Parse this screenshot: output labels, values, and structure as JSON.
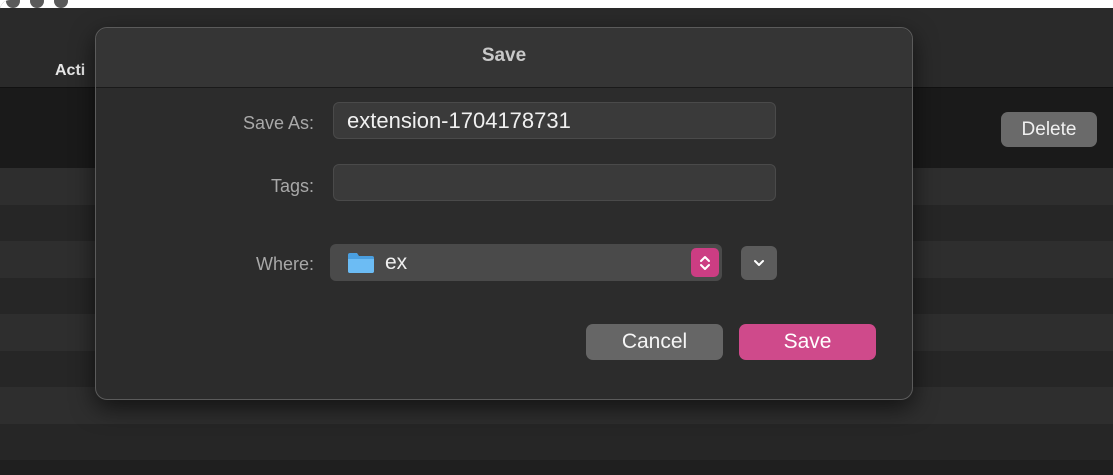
{
  "window": {
    "toolbar_label": "Acti",
    "delete_label": "Delete",
    "row_count": 8
  },
  "dialog": {
    "title": "Save",
    "save_as_label": "Save As:",
    "save_as_value": "extension-1704178731",
    "tags_label": "Tags:",
    "tags_value": "",
    "where_label": "Where:",
    "where_value": "ex",
    "where_icon": "folder-icon",
    "cancel_label": "Cancel",
    "save_label": "Save"
  },
  "colors": {
    "accent": "#cf4a8b",
    "folder": "#5aaff0"
  }
}
